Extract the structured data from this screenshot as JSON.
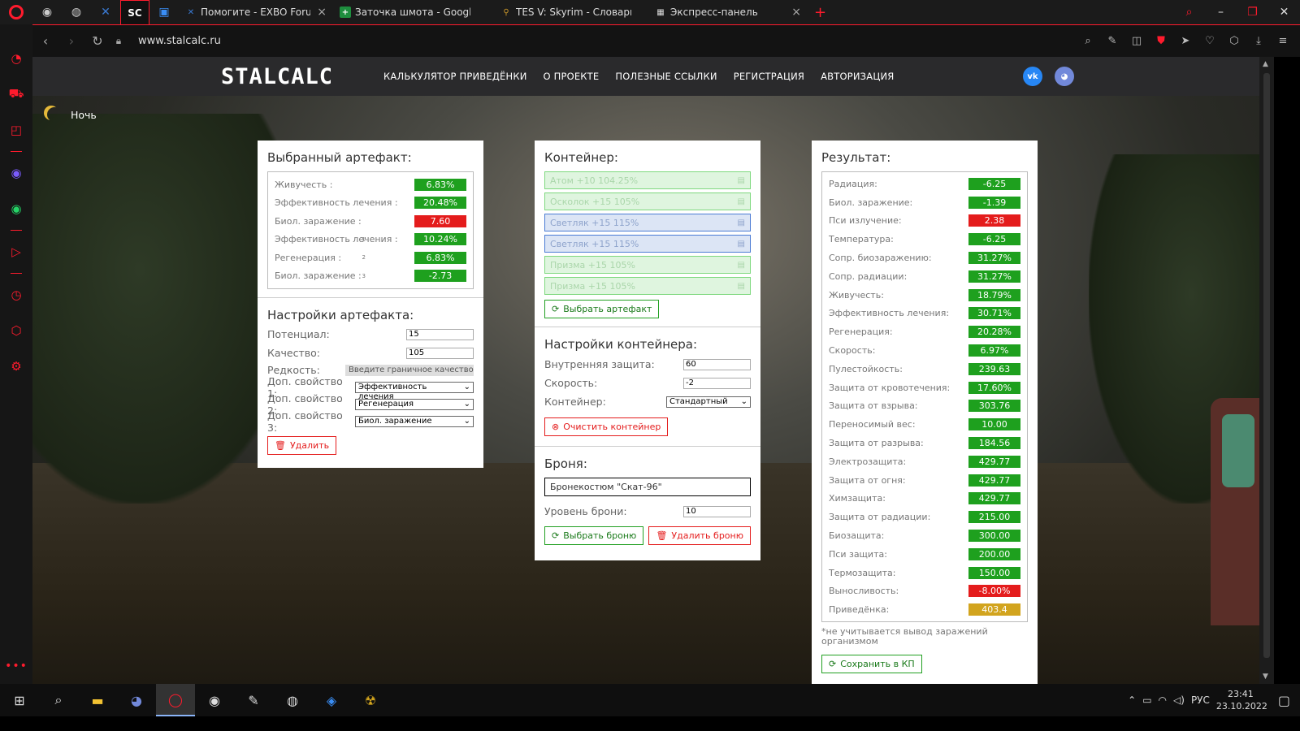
{
  "browser": {
    "tabs": [
      {
        "label": "Помогите - EXBO Forum",
        "icon": "exbo-icon",
        "color": "#2255aa"
      },
      {
        "label": "Заточка шмота - Google Т",
        "icon": "sheets-icon",
        "color": "#1e8e3e"
      },
      {
        "label": "TES V: Skyrim - Словарь др",
        "icon": "skyrim-icon",
        "color": "#a87a2a"
      },
      {
        "label": "Экспресс-панель",
        "icon": "speed-dial-icon",
        "color": "#777777"
      }
    ],
    "url": "www.stalcalc.ru"
  },
  "site": {
    "logo": "STALCALC",
    "menu": [
      "КАЛЬКУЛЯТОР ПРИВЕДЁНКИ",
      "О ПРОЕКТЕ",
      "ПОЛЕЗНЫЕ ССЫЛКИ",
      "РЕГИСТРАЦИЯ",
      "АВТОРИЗАЦИЯ"
    ],
    "night_label": "Ночь"
  },
  "artifact": {
    "title": "Выбранный артефакт:",
    "stats": [
      {
        "label": "Живучесть :",
        "value": "6.83%",
        "color": "green"
      },
      {
        "label": "Эффективность лечения :",
        "value": "20.48%",
        "color": "green"
      },
      {
        "label": "Биол. заражение :",
        "value": "7.60",
        "color": "red"
      },
      {
        "label": "Эффективность лечения :",
        "sup": "1",
        "value": "10.24%",
        "color": "green"
      },
      {
        "label": "Регенерация :",
        "sup": "2",
        "value": "6.83%",
        "color": "green"
      },
      {
        "label": "Биол. заражение :",
        "sup": "3",
        "value": "-2.73",
        "color": "green"
      }
    ],
    "settings_title": "Настройки артефакта:",
    "potential_label": "Потенциал:",
    "potential_value": "15",
    "quality_label": "Качество:",
    "quality_value": "105",
    "rarity_label": "Редкость:",
    "rarity_placeholder": "Введите граничное качество",
    "prop1_label": "Доп. свойство 1:",
    "prop1_value": "Эффективность лечения",
    "prop2_label": "Доп. свойство 2:",
    "prop2_value": "Регенерация",
    "prop3_label": "Доп. свойство 3:",
    "prop3_value": "Биол. заражение",
    "delete_label": "Удалить"
  },
  "container": {
    "title": "Контейнер:",
    "slots": [
      {
        "label": "Атом +10 104.25%",
        "type": "green"
      },
      {
        "label": "Осколок +15 105%",
        "type": "green"
      },
      {
        "label": "Светляк +15 115%",
        "type": "blue"
      },
      {
        "label": "Светляк +15 115%",
        "type": "blue"
      },
      {
        "label": "Призма +15 105%",
        "type": "green"
      },
      {
        "label": "Призма +15 105%",
        "type": "green"
      }
    ],
    "select_artifact_label": "Выбрать артефакт",
    "settings_title": "Настройки контейнера:",
    "inner_protection_label": "Внутренняя защита:",
    "inner_protection_value": "60",
    "speed_label": "Скорость:",
    "speed_value": "-2",
    "container_label": "Контейнер:",
    "container_value": "Стандартный",
    "clear_label": "Очистить контейнер"
  },
  "armor": {
    "title": "Броня:",
    "name": "Бронекостюм \"Скат-96\"",
    "level_label": "Уровень брони:",
    "level_value": "10",
    "select_label": "Выбрать броню",
    "delete_label": "Удалить броню"
  },
  "result": {
    "title": "Результат:",
    "stats": [
      {
        "label": "Радиация:",
        "value": "-6.25",
        "color": "green"
      },
      {
        "label": "Биол. заражение:",
        "value": "-1.39",
        "color": "green"
      },
      {
        "label": "Пси излучение:",
        "value": "2.38",
        "color": "red"
      },
      {
        "label": "Температура:",
        "value": "-6.25",
        "color": "green"
      },
      {
        "label": "Сопр. биозаражению:",
        "value": "31.27%",
        "color": "green"
      },
      {
        "label": "Сопр. радиации:",
        "value": "31.27%",
        "color": "green"
      },
      {
        "label": "Живучесть:",
        "value": "18.79%",
        "color": "green"
      },
      {
        "label": "Эффективность лечения:",
        "value": "30.71%",
        "color": "green"
      },
      {
        "label": "Регенерация:",
        "value": "20.28%",
        "color": "green"
      },
      {
        "label": "Скорость:",
        "value": "6.97%",
        "color": "green"
      },
      {
        "label": "Пулестойкость:",
        "value": "239.63",
        "color": "green"
      },
      {
        "label": "Защита от кровотечения:",
        "value": "17.60%",
        "color": "green"
      },
      {
        "label": "Защита от взрыва:",
        "value": "303.76",
        "color": "green"
      },
      {
        "label": "Переносимый вес:",
        "value": "10.00",
        "color": "green"
      },
      {
        "label": "Защита от разрыва:",
        "value": "184.56",
        "color": "green"
      },
      {
        "label": "Электрозащита:",
        "value": "429.77",
        "color": "green"
      },
      {
        "label": "Защита от огня:",
        "value": "429.77",
        "color": "green"
      },
      {
        "label": "Химзащита:",
        "value": "429.77",
        "color": "green"
      },
      {
        "label": "Защита от радиации:",
        "value": "215.00",
        "color": "green"
      },
      {
        "label": "Биозащита:",
        "value": "300.00",
        "color": "green"
      },
      {
        "label": "Пси защита:",
        "value": "200.00",
        "color": "green"
      },
      {
        "label": "Термозащита:",
        "value": "150.00",
        "color": "green"
      },
      {
        "label": "Выносливость:",
        "value": "-8.00%",
        "color": "red"
      },
      {
        "label": "Приведёнка:",
        "value": "403.4",
        "color": "yellow"
      }
    ],
    "note": "*не учитывается вывод заражений организмом",
    "save_label": "Сохранить в КП"
  },
  "taskbar": {
    "lang": "РУС",
    "time": "23:41",
    "date": "23.10.2022"
  }
}
